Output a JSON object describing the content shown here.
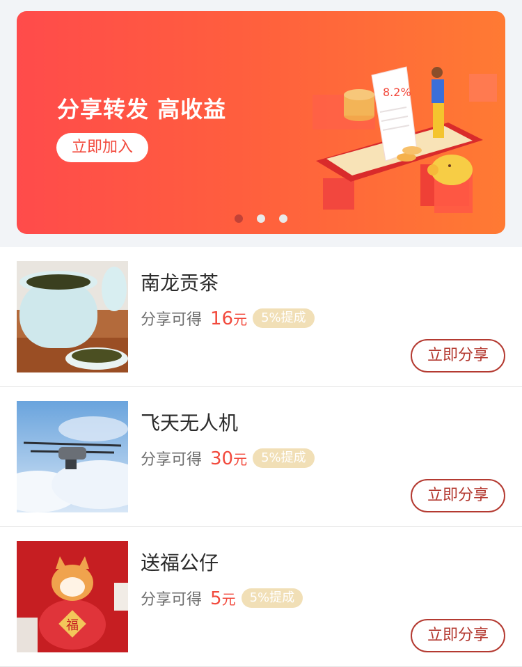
{
  "banner": {
    "title": "分享转发 高收益",
    "button_label": "立即加入",
    "art_rate": "8.2%",
    "dots_count": 3,
    "active_dot": 0
  },
  "products": [
    {
      "name": "南龙贡茶",
      "earn_label": "分享可得",
      "amount": "16",
      "unit": "元",
      "badge": "5%提成",
      "share_label": "立即分享",
      "image": "tea-jar"
    },
    {
      "name": "飞天无人机",
      "earn_label": "分享可得",
      "amount": "30",
      "unit": "元",
      "badge": "5%提成",
      "share_label": "立即分享",
      "image": "drone"
    },
    {
      "name": "送福公仔",
      "earn_label": "分享可得",
      "amount": "5",
      "unit": "元",
      "badge": "5%提成",
      "share_label": "立即分享",
      "image": "lucky-dog-figurine"
    }
  ],
  "colors": {
    "accent": "#f24a3d",
    "share_border": "#b43a31",
    "badge_bg": "#f1dfb6"
  }
}
